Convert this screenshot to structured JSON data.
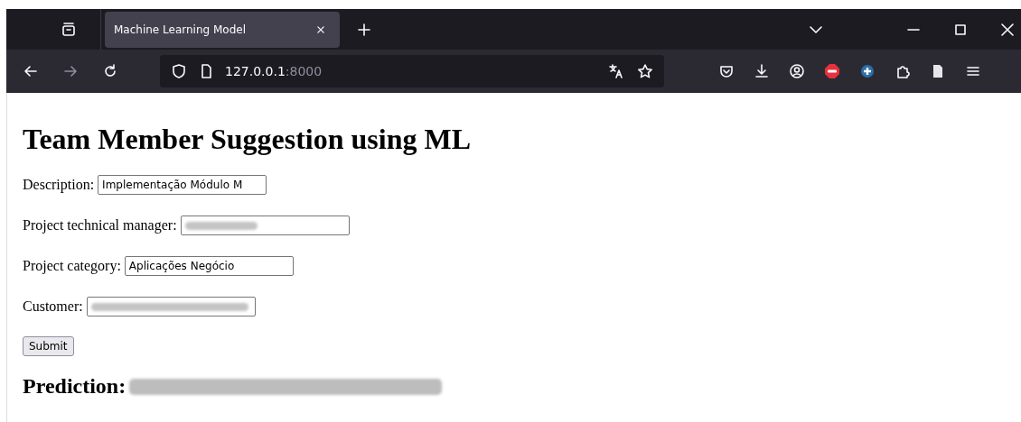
{
  "browser": {
    "tabs": [
      {
        "title": "Machine Learning Model",
        "selected": true
      }
    ],
    "url": {
      "host": "127.0.0.1",
      "port": ":8000"
    }
  },
  "page": {
    "heading": "Team Member Suggestion using ML",
    "fields": [
      {
        "label": "Description:",
        "value": "Implementação Módulo M",
        "redacted": false
      },
      {
        "label": "Project technical manager:",
        "redacted": true
      },
      {
        "label": "Project category:",
        "value": "Aplicações Negócio",
        "redacted": false
      },
      {
        "label": "Customer:",
        "redacted": true
      }
    ],
    "submit": "Submit",
    "prediction": {
      "label": "Prediction:",
      "redacted": true
    }
  }
}
